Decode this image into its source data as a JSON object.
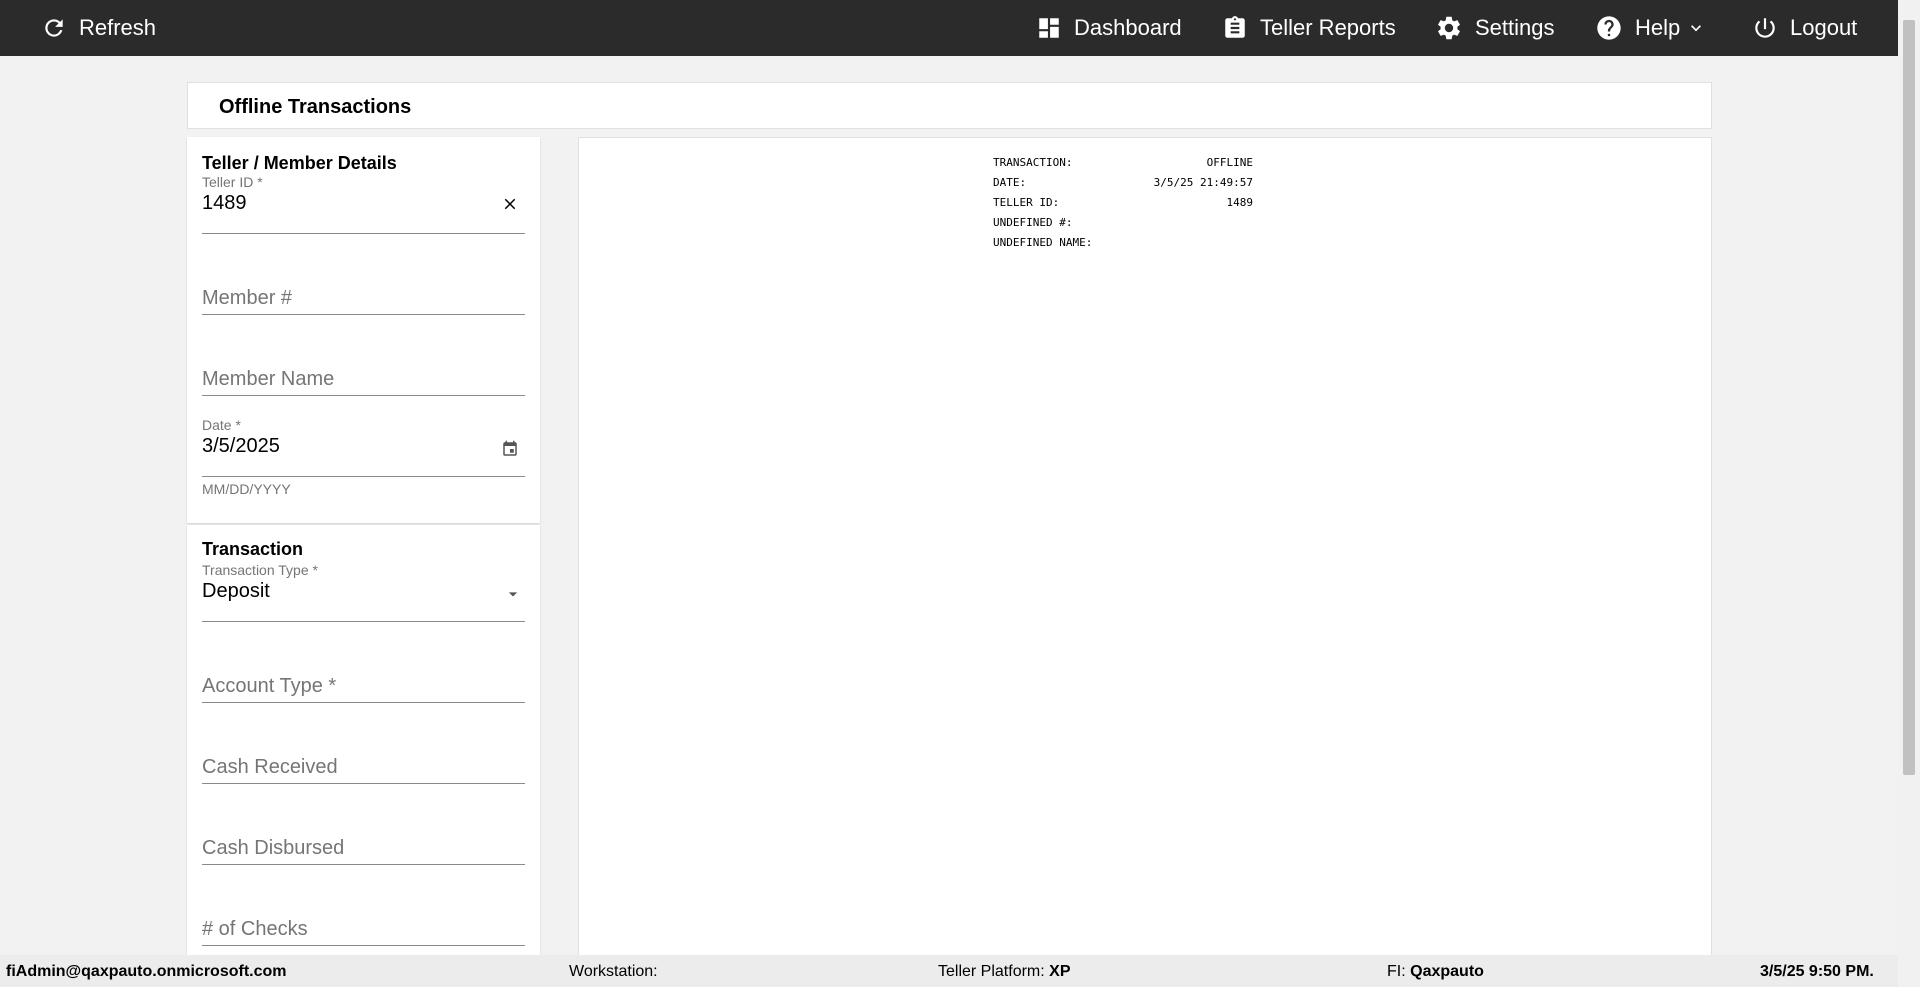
{
  "topbar": {
    "refresh": "Refresh",
    "dashboard": "Dashboard",
    "teller_reports": "Teller Reports",
    "settings": "Settings",
    "help": "Help",
    "logout": "Logout",
    "icons": [
      "refresh-icon",
      "dashboard-icon",
      "clipboard-icon",
      "gear-icon",
      "help-circle-icon",
      "chevron-down-icon",
      "power-icon"
    ]
  },
  "page": {
    "title": "Offline Transactions"
  },
  "teller_member": {
    "heading": "Teller / Member Details",
    "teller_id_label": "Teller ID *",
    "teller_id_value": "1489",
    "member_number_placeholder": "Member #",
    "member_name_placeholder": "Member Name",
    "date_label": "Date *",
    "date_value": "3/5/2025",
    "date_hint": "MM/DD/YYYY"
  },
  "transaction": {
    "heading": "Transaction",
    "type_label": "Transaction Type *",
    "type_value": "Deposit",
    "account_type_placeholder": "Account Type *",
    "cash_received_placeholder": "Cash Received",
    "cash_disbursed_placeholder": "Cash Disbursed",
    "num_checks_placeholder": "# of Checks"
  },
  "receipt": {
    "lines": [
      {
        "key": "TRANSACTION:",
        "value": "OFFLINE"
      },
      {
        "key": "DATE:",
        "value": "3/5/25 21:49:57"
      },
      {
        "key": "TELLER ID:",
        "value": "1489"
      },
      {
        "key": "UNDEFINED #:",
        "value": ""
      },
      {
        "key": "UNDEFINED NAME:",
        "value": ""
      }
    ]
  },
  "statusbar": {
    "user": "fiAdmin@qaxpauto.onmicrosoft.com",
    "workstation_label": "Workstation:",
    "workstation_value": "",
    "platform_label": "Teller Platform:",
    "platform_value": "XP",
    "fi_label": "FI:",
    "fi_value": "Qaxpauto",
    "datetime": "3/5/25 9:50 PM."
  }
}
